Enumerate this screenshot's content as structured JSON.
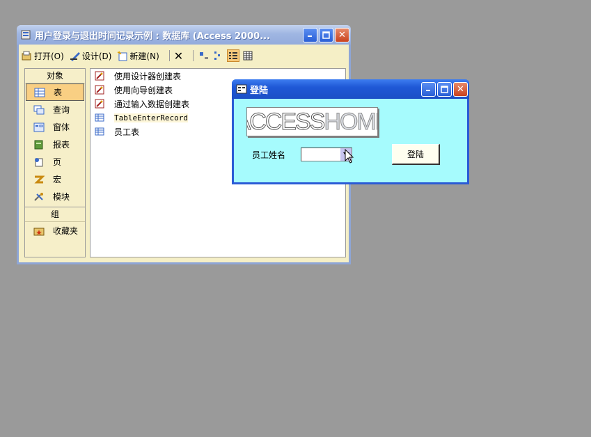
{
  "db_window": {
    "title": "用户登录与退出时间记录示例 : 数据库 (Access 2000...",
    "toolbar": {
      "open_label": "打开(O)",
      "design_label": "设计(D)",
      "new_label": "新建(N)"
    },
    "objects_header": "对象",
    "objects": [
      {
        "label": "表",
        "icon": "table-icon",
        "selected": true
      },
      {
        "label": "查询",
        "icon": "query-icon"
      },
      {
        "label": "窗体",
        "icon": "form-icon"
      },
      {
        "label": "报表",
        "icon": "report-icon"
      },
      {
        "label": "页",
        "icon": "page-icon"
      },
      {
        "label": "宏",
        "icon": "macro-icon"
      },
      {
        "label": "模块",
        "icon": "module-icon"
      }
    ],
    "groups_header": "组",
    "groups": [
      {
        "label": "收藏夹",
        "icon": "favorites-folder-icon"
      }
    ],
    "list_items": [
      {
        "label": "使用设计器创建表",
        "icon": "wizard-icon"
      },
      {
        "label": "使用向导创建表",
        "icon": "wizard-icon"
      },
      {
        "label": "通过输入数据创建表",
        "icon": "wizard-icon"
      },
      {
        "label": "TableEnterRecord",
        "icon": "table-icon"
      },
      {
        "label": "员工表",
        "icon": "table-icon"
      }
    ]
  },
  "login_dialog": {
    "title": "登陆",
    "logo_text_a": "ACCESS",
    "logo_text_b": "HOME",
    "employee_label": "员工姓名",
    "employee_value": "",
    "login_button": "登陆"
  },
  "colors": {
    "desktop": "#9a9a9a",
    "db_window_bg": "#f5efc6",
    "login_bg": "#a6fbfd",
    "selected_item": "#f9cf83"
  }
}
